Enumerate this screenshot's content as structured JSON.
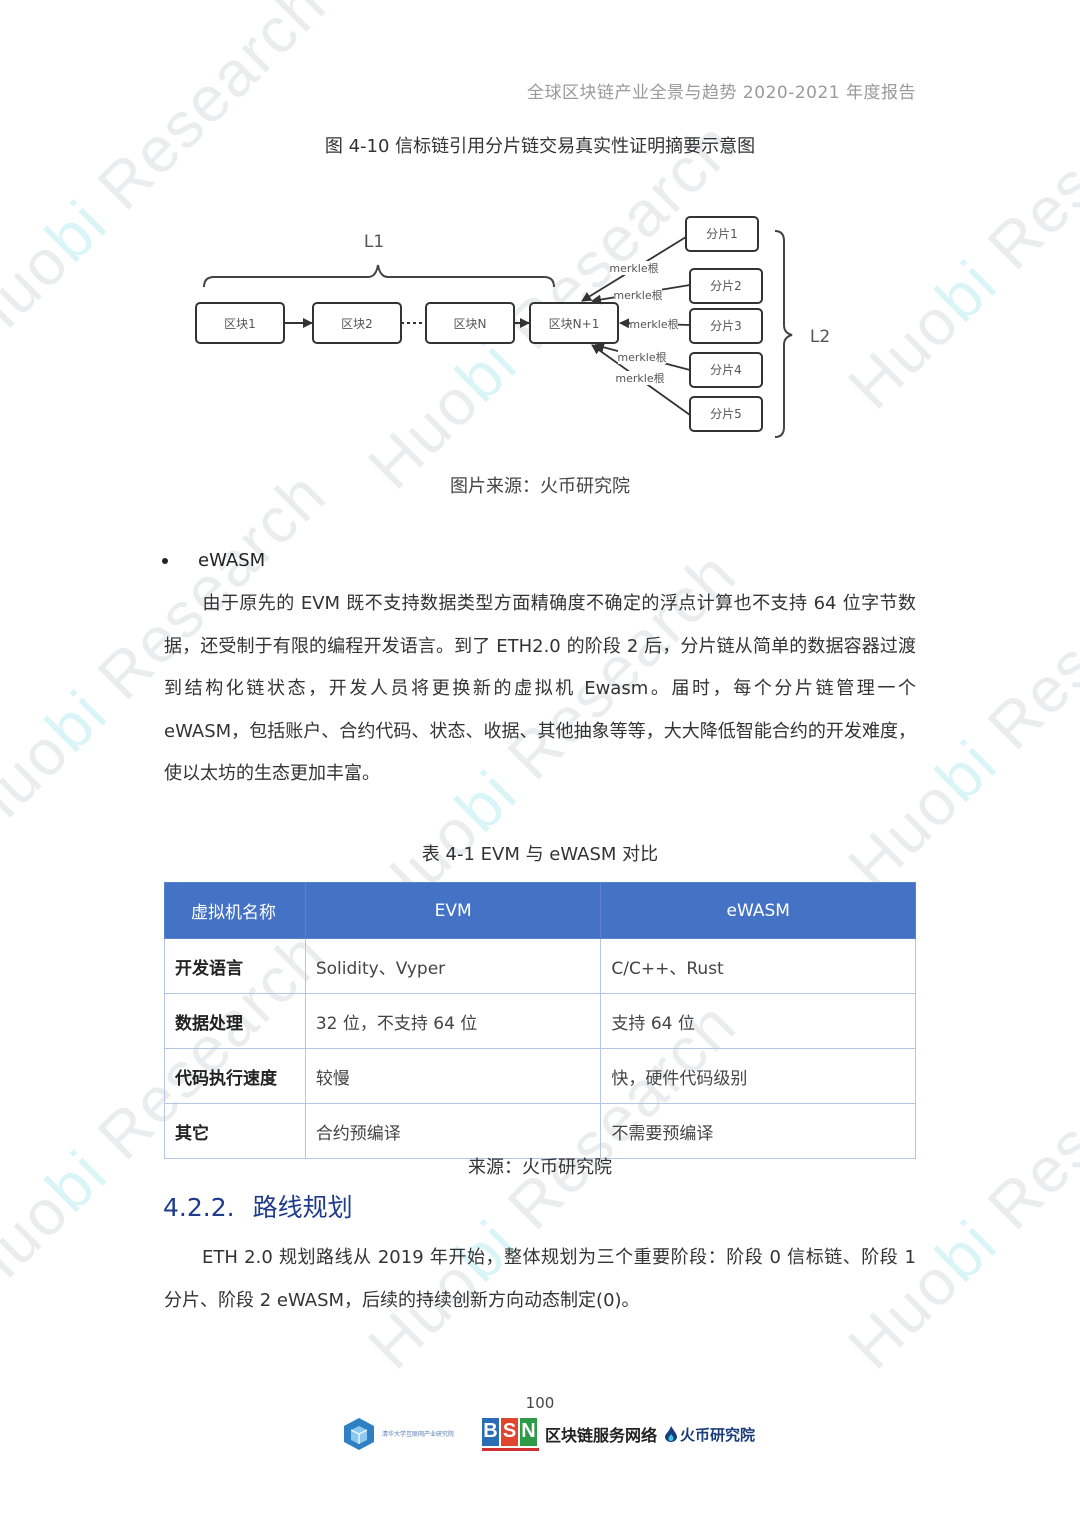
{
  "header": {
    "running_title": "全球区块链产业全景与趋势  2020-2021 年度报告"
  },
  "watermark": {
    "text_prefix": "Huo",
    "text_accent": "bi",
    "text_suffix": " Research"
  },
  "figure": {
    "caption": "图 4-10  信标链引用分片链交易真实性证明摘要示意图",
    "source": "图片来源：火币研究院",
    "l1_label": "L1",
    "l2_label": "L2",
    "blocks": [
      "区块1",
      "区块2",
      "区块N",
      "区块N+1"
    ],
    "shards": [
      "分片1",
      "分片2",
      "分片3",
      "分片4",
      "分片5"
    ],
    "edge_label": "merkle根"
  },
  "section_ewasm": {
    "bullet": "eWASM",
    "paragraph": "由于原先的 EVM 既不支持数据类型方面精确度不确定的浮点计算也不支持 64 位字节数据，还受制于有限的编程开发语言。到了 ETH2.0 的阶段 2 后，分片链从简单的数据容器过渡到结构化链状态，开发人员将更换新的虚拟机 Ewasm。届时，每个分片链管理一个 eWASM，包括账户、合约代码、状态、收据、其他抽象等等，大大降低智能合约的开发难度，使以太坊的生态更加丰富。"
  },
  "table": {
    "caption": "表 4-1 EVM 与 eWASM 对比",
    "headers": [
      "虚拟机名称",
      "EVM",
      "eWASM"
    ],
    "rows": [
      [
        "开发语言",
        "Solidity、Vyper",
        "C/C++、Rust"
      ],
      [
        "数据处理",
        "32 位，不支持 64 位",
        "支持 64 位"
      ],
      [
        "代码执行速度",
        "较慢",
        "快，硬件代码级别"
      ],
      [
        "其它",
        "合约预编译",
        "不需要预编译"
      ]
    ],
    "source": "来源：火币研究院",
    "header_color": "#4472c4"
  },
  "section_roadmap": {
    "number": "4.2.2.",
    "title": "路线规划",
    "paragraph": "ETH 2.0 规划路线从 2019 年开始，整体规划为三个重要阶段：阶段 0  信标链、阶段 1 分片、阶段 2 eWASM，后续的持续创新方向动态制定(0)。"
  },
  "footer": {
    "page_number": "100",
    "logo1_text": "清华大学互联网产业研究院",
    "bsn_letters": [
      "B",
      "S",
      "N"
    ],
    "bsn_label": "区块链服务网络",
    "huobi_label": "火币研究院"
  }
}
